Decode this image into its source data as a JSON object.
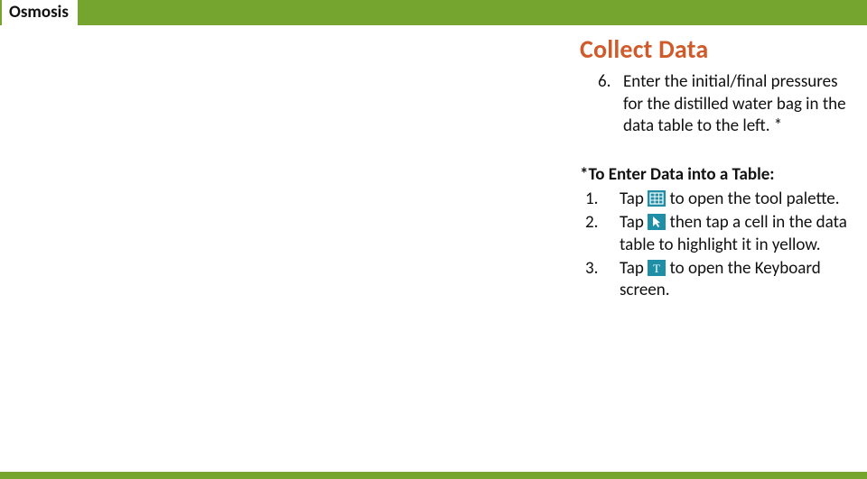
{
  "header": {
    "title": "Osmosis"
  },
  "section": {
    "heading": "Collect Data"
  },
  "step6": {
    "marker": "6.",
    "text": "Enter the initial/final pressures for the distilled water bag in the data table to the left. *"
  },
  "subheading": "*To Enter Data into a Table:",
  "substeps": [
    {
      "marker": "1.",
      "pre": "Tap ",
      "icon": "table-tool-icon",
      "post": " to open the tool palette."
    },
    {
      "marker": "2.",
      "pre": "Tap ",
      "icon": "pointer-tool-icon",
      "post": " then tap a cell in the data table to highlight it in yellow."
    },
    {
      "marker": "3.",
      "pre": "Tap ",
      "icon": "text-tool-icon",
      "post": " to open the Keyboard screen."
    }
  ]
}
